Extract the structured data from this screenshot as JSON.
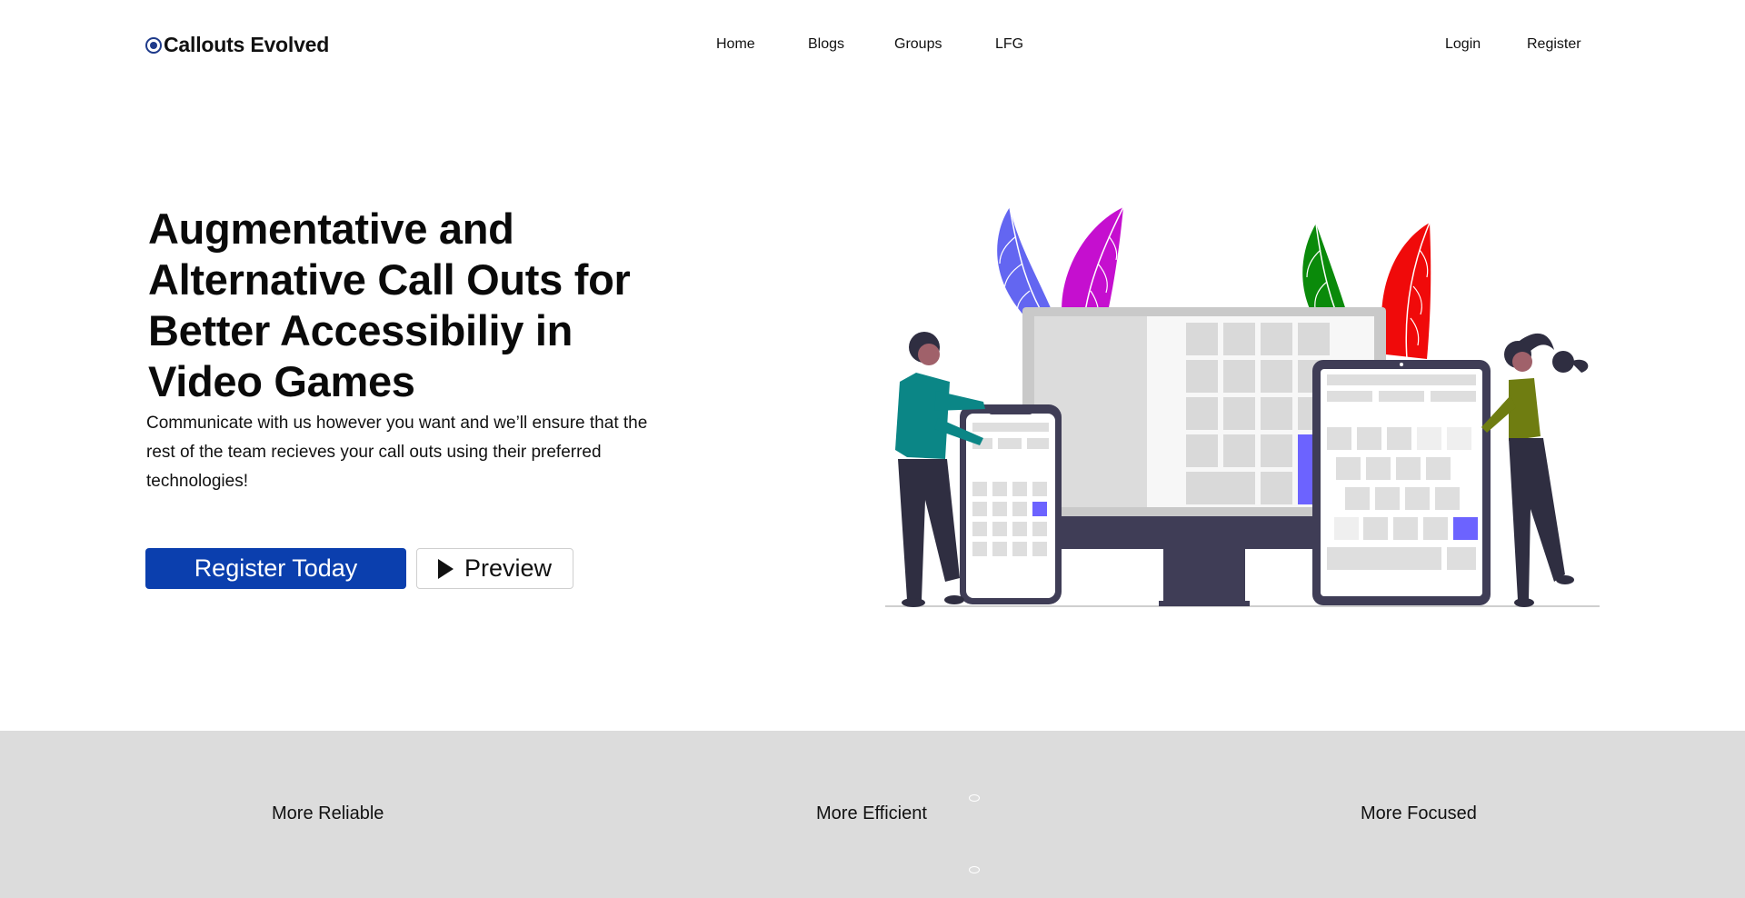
{
  "brand": {
    "name": "Callouts Evolved"
  },
  "nav": {
    "center": [
      "Home",
      "Blogs",
      "Groups",
      "LFG"
    ],
    "right": [
      "Login",
      "Register"
    ]
  },
  "hero": {
    "title": "Augmentative and Alternative Call Outs for Better Accessibiliy in Video Games",
    "subtitle": "Communicate with us however you want and we’ll ensure that the rest of the team recieves your call outs using their preferred technologies!",
    "primary_button": "Register Today",
    "secondary_button": "Preview"
  },
  "features": [
    "More Reliable",
    "More Efficient",
    "More Focused"
  ],
  "colors": {
    "primary": "#0b3fae",
    "features_bg": "#dcdcdc",
    "leaf_blue": "#6366f1",
    "leaf_magenta": "#c50fcf",
    "leaf_green": "#0a8a0a",
    "leaf_red": "#f00a0a",
    "device_dark": "#3f3d56",
    "accent_square": "#6c63ff",
    "shirt_teal": "#0b8686",
    "shirt_olive": "#6f7d11"
  },
  "icons": {
    "brand": "brand-logo-icon",
    "preview": "play-icon"
  }
}
